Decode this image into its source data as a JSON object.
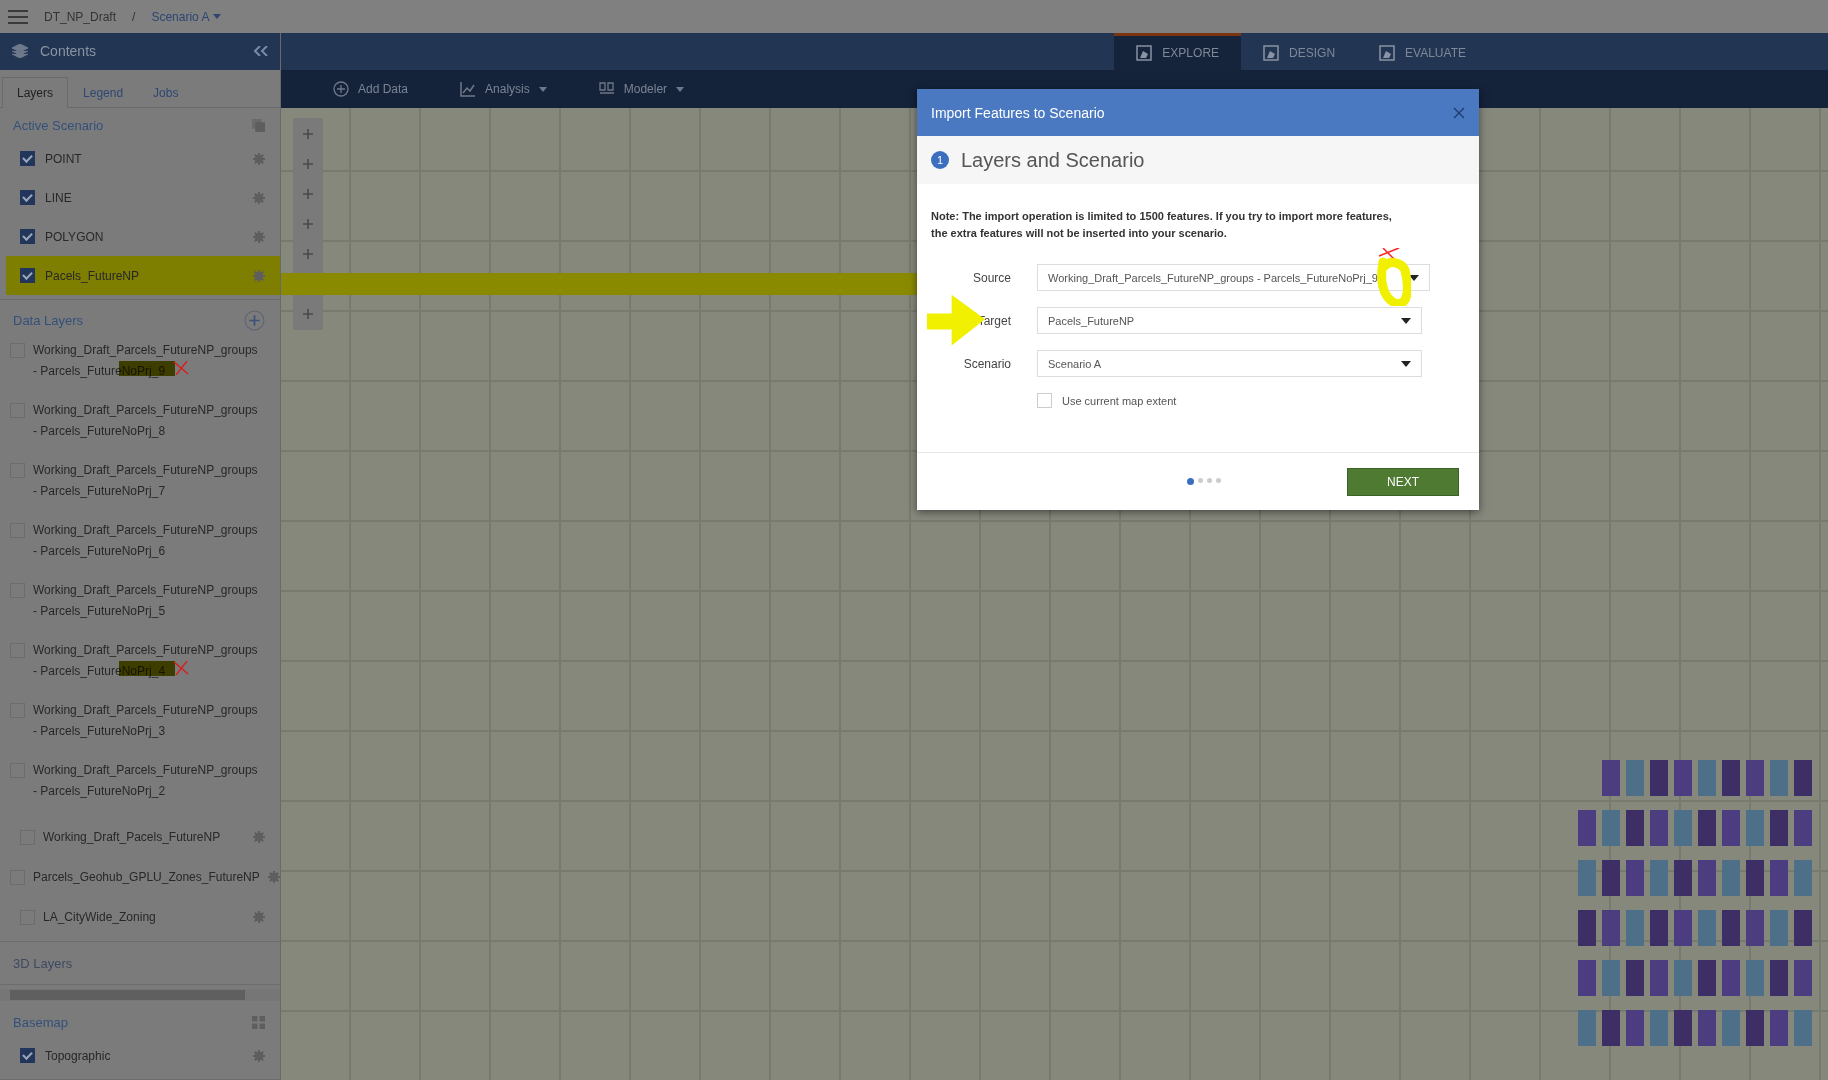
{
  "topbar": {
    "project": "DT_NP_Draft",
    "separator": "/",
    "scenario": "Scenario A"
  },
  "sidebar": {
    "title": "Contents",
    "tabs": [
      {
        "label": "Layers",
        "selected": true
      },
      {
        "label": "Legend",
        "selected": false
      },
      {
        "label": "Jobs",
        "selected": false
      }
    ],
    "active_scenario": {
      "title": "Active Scenario",
      "items": [
        {
          "label": "POINT",
          "checked": true,
          "highlighted": false
        },
        {
          "label": "LINE",
          "checked": true,
          "highlighted": false
        },
        {
          "label": "POLYGON",
          "checked": true,
          "highlighted": false
        },
        {
          "label": "Pacels_FutureNP",
          "checked": true,
          "highlighted": true
        }
      ]
    },
    "data_layers": {
      "title": "Data Layers",
      "items": [
        {
          "line1": "Working_Draft_Parcels_FutureNP_groups",
          "line2": "- Parcels_FutureNoPrj_9",
          "checked": false,
          "indented": false,
          "gear": false,
          "marked": true
        },
        {
          "line1": "Working_Draft_Parcels_FutureNP_groups",
          "line2": "- Parcels_FutureNoPrj_8",
          "checked": false,
          "indented": false,
          "gear": false,
          "marked": false
        },
        {
          "line1": "Working_Draft_Parcels_FutureNP_groups",
          "line2": "- Parcels_FutureNoPrj_7",
          "checked": false,
          "indented": false,
          "gear": false,
          "marked": false
        },
        {
          "line1": "Working_Draft_Parcels_FutureNP_groups",
          "line2": "- Parcels_FutureNoPrj_6",
          "checked": false,
          "indented": false,
          "gear": false,
          "marked": false
        },
        {
          "line1": "Working_Draft_Parcels_FutureNP_groups",
          "line2": "- Parcels_FutureNoPrj_5",
          "checked": false,
          "indented": false,
          "gear": false,
          "marked": false
        },
        {
          "line1": "Working_Draft_Parcels_FutureNP_groups",
          "line2": "- Parcels_FutureNoPrj_4",
          "checked": false,
          "indented": false,
          "gear": false,
          "marked": true
        },
        {
          "line1": "Working_Draft_Parcels_FutureNP_groups",
          "line2": "- Parcels_FutureNoPrj_3",
          "checked": false,
          "indented": false,
          "gear": false,
          "marked": false
        },
        {
          "line1": "Working_Draft_Parcels_FutureNP_groups",
          "line2": "- Parcels_FutureNoPrj_2",
          "checked": false,
          "indented": false,
          "gear": false,
          "marked": false
        },
        {
          "line1": "Working_Draft_Pacels_FutureNP",
          "checked": false,
          "indented": true,
          "gear": true
        },
        {
          "line1": "Parcels_Geohub_GPLU_Zones_FutureNP",
          "checked": false,
          "indented": false,
          "gear": true
        },
        {
          "line1": "LA_CityWide_Zoning",
          "checked": false,
          "indented": true,
          "gear": true
        }
      ]
    },
    "layers_3d": {
      "title": "3D Layers"
    },
    "basemap": {
      "title": "Basemap",
      "items": [
        {
          "label": "Topographic",
          "checked": true
        }
      ]
    }
  },
  "mode_tabs": [
    {
      "label": "EXPLORE",
      "selected": true
    },
    {
      "label": "DESIGN",
      "selected": false
    },
    {
      "label": "EVALUATE",
      "selected": false
    }
  ],
  "toolbar": [
    {
      "label": "Add Data",
      "dropdown": false
    },
    {
      "label": "Analysis",
      "dropdown": true
    },
    {
      "label": "Modeler",
      "dropdown": true
    }
  ],
  "dialog": {
    "title": "Import Features to Scenario",
    "step_number": "1",
    "step_title": "Layers and Scenario",
    "note": "Note: The import operation is limited to 1500 features. If you try to import more features, the extra features will not be inserted into your scenario.",
    "fields": [
      {
        "label": "Source",
        "value": "Working_Draft_Parcels_FutureNP_groups - Parcels_FutureNoPrj_9",
        "marked": true
      },
      {
        "label": "Target",
        "value": "Pacels_FutureNP",
        "marked": false,
        "arrow": true
      },
      {
        "label": "Scenario",
        "value": "Scenario A",
        "marked": false
      }
    ],
    "checkbox": {
      "label": "Use current map extent",
      "checked": false
    },
    "pager": [
      {
        "selected": true
      },
      {
        "selected": false
      },
      {
        "selected": false
      },
      {
        "selected": false
      }
    ],
    "next_button": "NEXT"
  }
}
